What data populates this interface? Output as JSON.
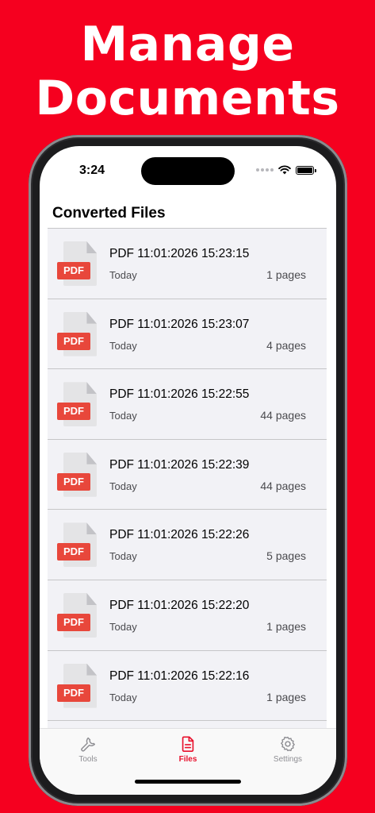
{
  "headline": [
    "Manage",
    "Documents"
  ],
  "status_bar": {
    "time": "3:24"
  },
  "page_title": "Converted Files",
  "badge_text": "PDF",
  "files": [
    {
      "name": "PDF 11:01:2026 15:23:15",
      "date": "Today",
      "pages": "1 pages"
    },
    {
      "name": "PDF 11:01:2026 15:23:07",
      "date": "Today",
      "pages": "4 pages"
    },
    {
      "name": "PDF 11:01:2026 15:22:55",
      "date": "Today",
      "pages": "44 pages"
    },
    {
      "name": "PDF 11:01:2026 15:22:39",
      "date": "Today",
      "pages": "44 pages"
    },
    {
      "name": "PDF 11:01:2026 15:22:26",
      "date": "Today",
      "pages": "5 pages"
    },
    {
      "name": "PDF 11:01:2026 15:22:20",
      "date": "Today",
      "pages": "1 pages"
    },
    {
      "name": "PDF 11:01:2026 15:22:16",
      "date": "Today",
      "pages": "1 pages"
    },
    {
      "name": "",
      "date": "",
      "pages": ""
    }
  ],
  "tab_bar": {
    "tools": {
      "label": "Tools",
      "icon": "wrench-icon"
    },
    "files": {
      "label": "Files",
      "icon": "document-icon",
      "active": true
    },
    "settings": {
      "label": "Settings",
      "icon": "gear-icon"
    }
  },
  "colors": {
    "background": "#f5001f",
    "accent": "#e8112d",
    "pdf_badge": "#e8473b",
    "list_background": "#f2f2f6"
  }
}
